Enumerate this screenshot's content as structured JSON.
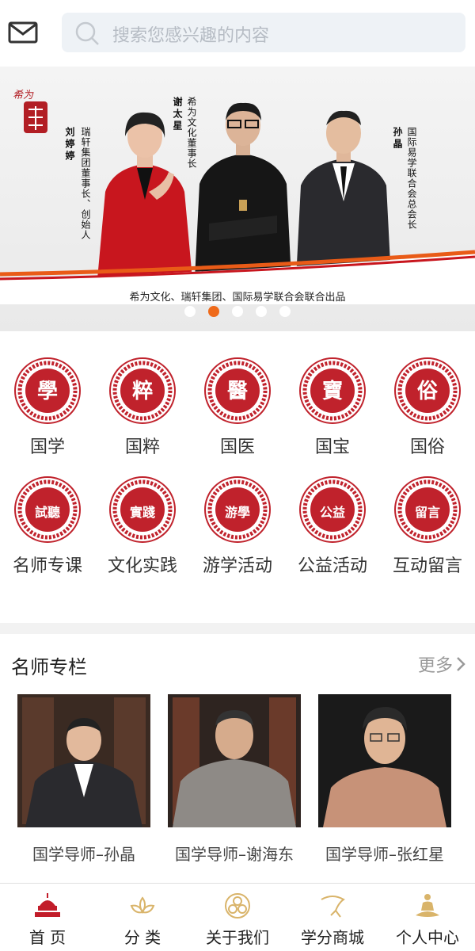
{
  "header": {
    "search_placeholder": "搜索您感兴趣的内容",
    "mail_icon": "mail-icon",
    "search_icon": "search-icon"
  },
  "banner": {
    "logo_text": "希为",
    "people": [
      {
        "name": "刘婷婷",
        "title": "瑞轩集团董事长、创始人"
      },
      {
        "name": "谢太星",
        "title": "希为文化董事长"
      },
      {
        "name": "孙晶",
        "title": "国际易学联合会总会长"
      }
    ],
    "caption": "希为文化、瑞轩集团、国际易学联合会联合出品",
    "slide_count": 5,
    "active_slide": 2
  },
  "categories": [
    {
      "seal": "學",
      "label": "国学"
    },
    {
      "seal": "粹",
      "label": "国粹"
    },
    {
      "seal": "醫",
      "label": "国医"
    },
    {
      "seal": "寶",
      "label": "国宝"
    },
    {
      "seal": "俗",
      "label": "国俗"
    },
    {
      "seal": "試聽",
      "label": "名师专课"
    },
    {
      "seal": "實踐",
      "label": "文化实践"
    },
    {
      "seal": "游學",
      "label": "游学活动"
    },
    {
      "seal": "公益",
      "label": "公益活动"
    },
    {
      "seal": "留言",
      "label": "互动留言"
    }
  ],
  "teachers": {
    "title": "名师专栏",
    "more_label": "更多",
    "items": [
      {
        "name": "国学导师–孙晶"
      },
      {
        "name": "国学导师–谢海东"
      },
      {
        "name": "国学导师–张红星"
      }
    ]
  },
  "tabbar": {
    "items": [
      {
        "label": "首 页",
        "icon": "temple-icon",
        "active": true
      },
      {
        "label": "分 类",
        "icon": "lotus-icon",
        "active": false
      },
      {
        "label": "关于我们",
        "icon": "emblem-icon",
        "active": false
      },
      {
        "label": "学分商城",
        "icon": "ribbon-icon",
        "active": false
      },
      {
        "label": "个人中心",
        "icon": "meditation-icon",
        "active": false
      }
    ]
  },
  "colors": {
    "accent": "#c21d2a",
    "dot_active": "#ef6a1a",
    "tab_icon": "#d9b46a",
    "seal_red": "#c0222c"
  }
}
